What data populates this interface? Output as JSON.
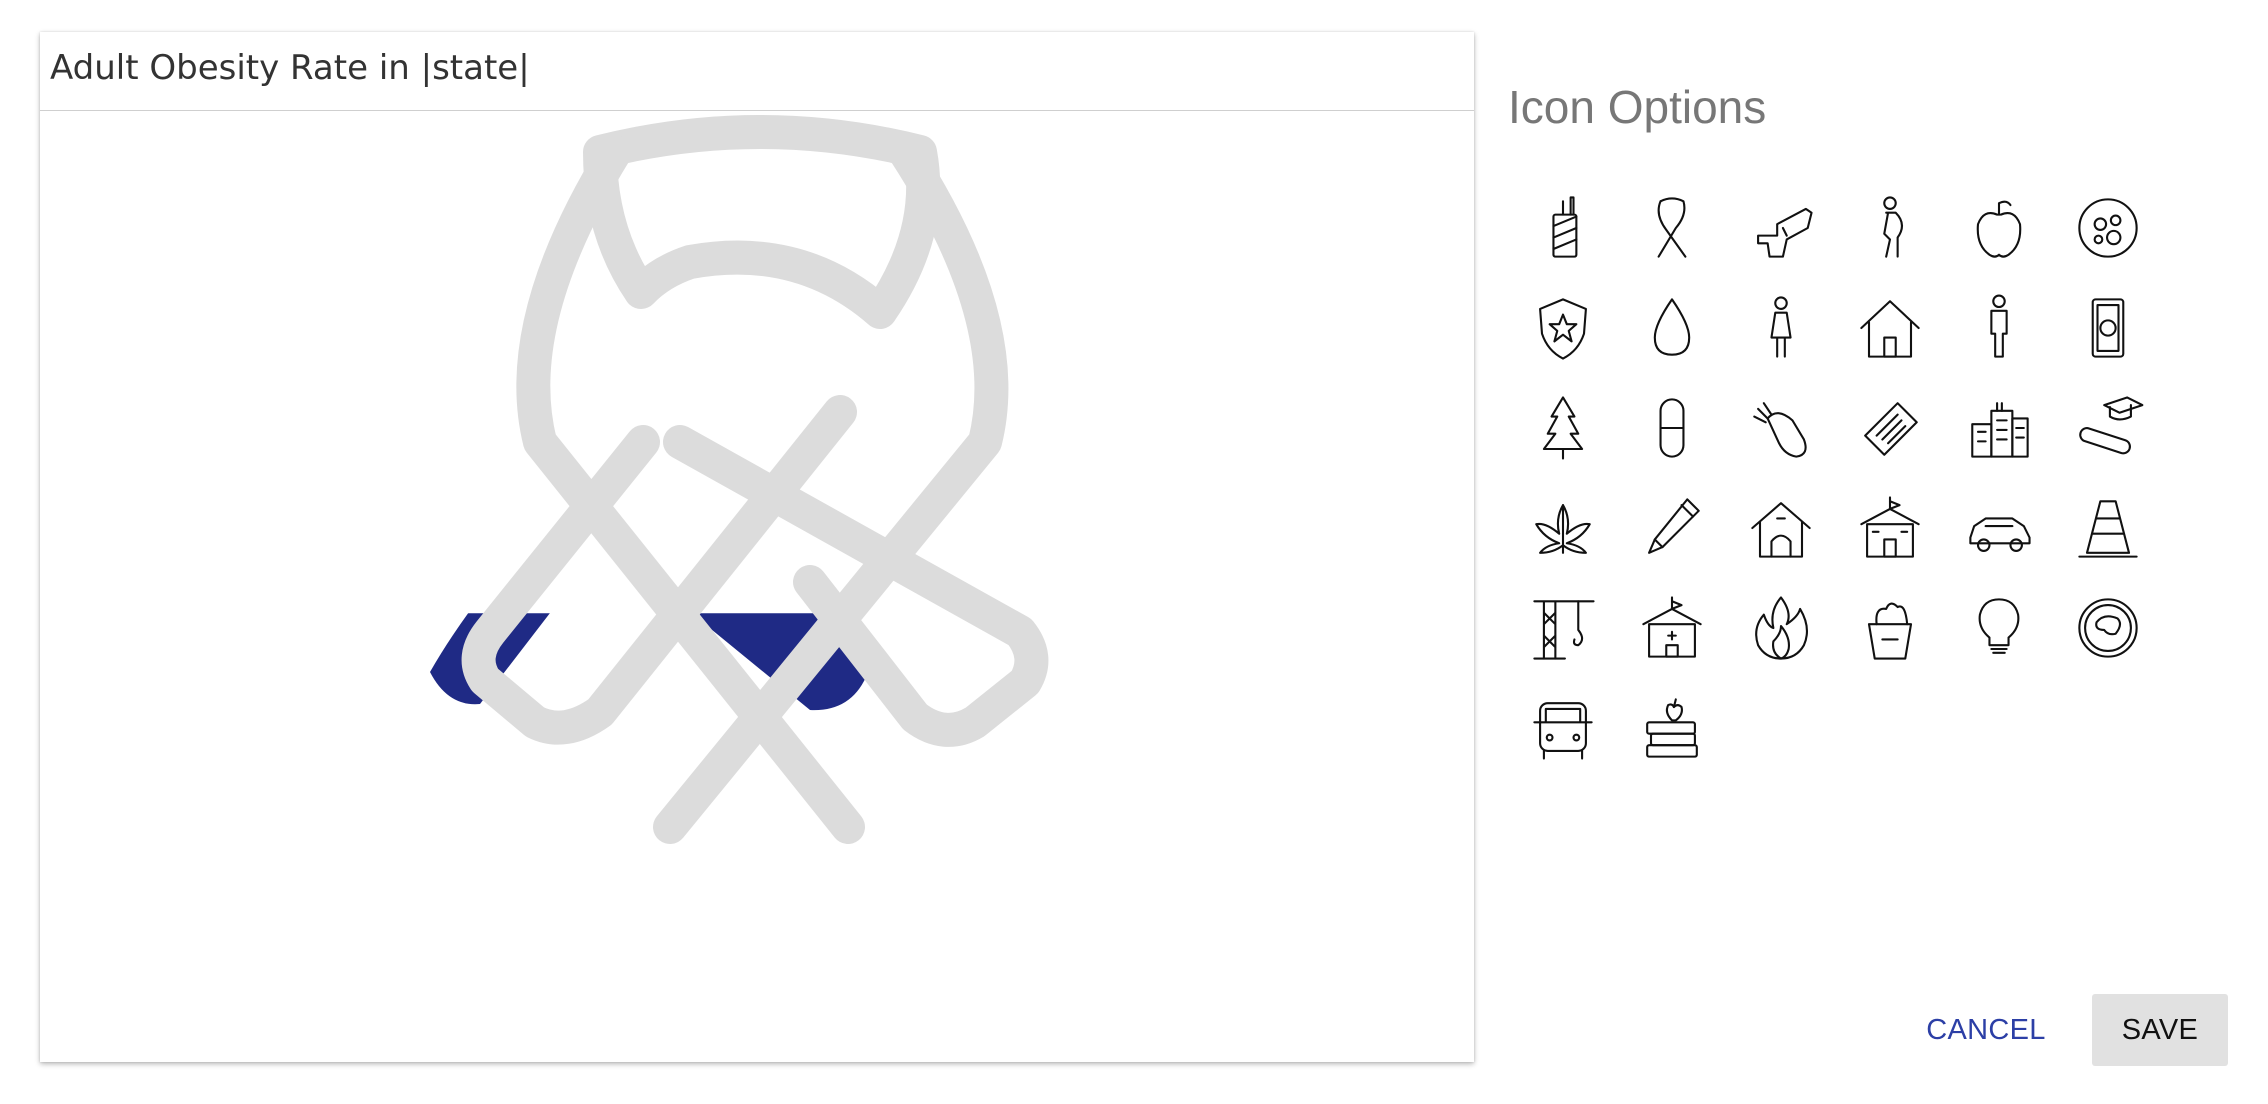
{
  "card": {
    "title": "Adult Obesity Rate in |state|"
  },
  "preview": {
    "icon": "awareness-ribbon-icon",
    "fill_fraction": 0.24,
    "fill_color": "#1f2a85",
    "outline_color": "#dcdcdc"
  },
  "icon_panel": {
    "title": "Icon Options",
    "icons": [
      "cigarette-pack-icon",
      "awareness-ribbon-icon",
      "handgun-icon",
      "pregnant-woman-icon",
      "apple-icon",
      "petri-dish-icon",
      "police-badge-icon",
      "water-drop-icon",
      "woman-icon",
      "house-icon",
      "man-icon",
      "money-bill-icon",
      "pine-tree-icon",
      "pill-capsule-icon",
      "bomb-icon",
      "ticket-icon",
      "city-buildings-icon",
      "graduation-diploma-icon",
      "cannabis-leaf-icon",
      "pencil-icon",
      "doghouse-icon",
      "school-house-icon",
      "car-icon",
      "traffic-cone-icon",
      "construction-crane-icon",
      "hospital-building-icon",
      "fire-icon",
      "grocery-bag-icon",
      "light-bulb-icon",
      "steak-plate-icon",
      "school-bus-icon",
      "books-apple-icon"
    ]
  },
  "actions": {
    "cancel_label": "CANCEL",
    "save_label": "SAVE"
  },
  "colors": {
    "accent": "#2c3fa6",
    "save_bg": "#e1e1e1"
  }
}
